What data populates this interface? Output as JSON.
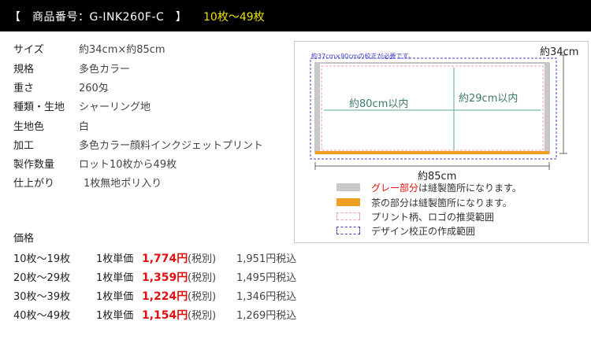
{
  "header": {
    "title": "【　商品番号：G-INK260F-C　】",
    "range": "10枚〜49枚"
  },
  "specs": [
    {
      "label": "サイズ",
      "value": "約34cm×約85cm"
    },
    {
      "label": "規格",
      "value": "多色カラー"
    },
    {
      "label": "重さ",
      "value": "260匁"
    },
    {
      "label": "種類・生地",
      "value": "シャーリング地"
    },
    {
      "label": "生地色",
      "value": "白"
    },
    {
      "label": "加工",
      "value": "多色カラー顔料インクジェットプリント"
    },
    {
      "label": "製作数量",
      "value": "ロット10枚から49枚"
    },
    {
      "label": "仕上がり",
      "value": "1枚無地ポリ入り"
    }
  ],
  "price": {
    "heading": "価格",
    "rows": [
      {
        "range": "10枚〜19枚",
        "unit": "1枚単価",
        "price": "1,774円",
        "tax_ex": "(税別)",
        "tax_in": "1,951円税込"
      },
      {
        "range": "20枚〜29枚",
        "unit": "1枚単価",
        "price": "1,359円",
        "tax_ex": "(税別)",
        "tax_in": "1,495円税込"
      },
      {
        "range": "30枚〜39枚",
        "unit": "1枚単価",
        "price": "1,224円",
        "tax_ex": "(税別)",
        "tax_in": "1,346円税込"
      },
      {
        "range": "40枚〜49枚",
        "unit": "1枚単価",
        "price": "1,154円",
        "tax_ex": "(税別)",
        "tax_in": "1,269円税込"
      }
    ]
  },
  "diagram": {
    "height_label": "約34cm",
    "width_label": "約85cm",
    "proof_note": "約37cm×90cmの校正が必要です。",
    "print_width_label": "約80cm以内",
    "print_height_label": "約29cm以内",
    "legend": [
      {
        "red_part": "グレー部分",
        "rest": "は縫製箇所になります。",
        "swatch": "gray"
      },
      {
        "red_part": "",
        "rest": "茶の部分は縫製箇所になります。",
        "swatch": "orange"
      },
      {
        "red_part": "",
        "rest": "プリント柄、ロゴの推奨範囲",
        "swatch": "pink-dashed"
      },
      {
        "red_part": "",
        "rest": "デザイン校正の作成範囲",
        "swatch": "blue-dashed"
      }
    ]
  },
  "colors": {
    "header_bg": "#000000",
    "header_accent": "#e8e000",
    "price_red": "#e01010",
    "seam_gray": "#c8c8c8",
    "seam_orange": "#f0a020",
    "print_area": "#f0a0a0",
    "proof_area": "#4040c0",
    "measure_line": "#5aa898"
  }
}
